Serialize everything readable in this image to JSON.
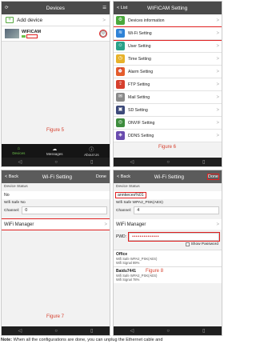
{
  "fig5": {
    "title": "Devices",
    "add_device": "Add device",
    "camera_name": "WIFICAM",
    "caption": "Figure 5",
    "tabs": [
      "Devices",
      "Messages",
      "About Us"
    ]
  },
  "fig6": {
    "back": "< List",
    "title": "WIFICAM Setting",
    "items": [
      {
        "label": "Devices information",
        "color": "#4aa83c"
      },
      {
        "label": "Wi-Fi Setting",
        "color": "#2f82d6"
      },
      {
        "label": "User Setting",
        "color": "#2aa189"
      },
      {
        "label": "Time Setting",
        "color": "#e7b22a"
      },
      {
        "label": "Alarm Setting",
        "color": "#e45d2b"
      },
      {
        "label": "FTP Setting",
        "color": "#d6402e"
      },
      {
        "label": "Mail Setting",
        "color": "#8a8a8a"
      },
      {
        "label": "SD Setting",
        "color": "#3d4a7a"
      },
      {
        "label": "ONVIF Setting",
        "color": "#3d8c3d"
      },
      {
        "label": "DDNS Setting",
        "color": "#6a4caf"
      }
    ],
    "caption": "Figure 6"
  },
  "fig7": {
    "back": "< Back",
    "title": "Wi-Fi Setting",
    "done": "Done",
    "device_status": "Device Status",
    "status_value": "No",
    "wifi_safe_label": "Wifi Safe",
    "wifi_safe_value": "No",
    "channel_label": "Channel:",
    "channel_value": "0",
    "wifi_manager": "WiFi Manager",
    "caption": "Figure 7"
  },
  "fig8": {
    "back": "< Back",
    "title": "Wi-Fi Setting",
    "done": "Done",
    "device_status": "Device Status",
    "ssid": "annkeces%01",
    "wifi_safe_label": "Wifi Safe",
    "wifi_safe_value": "WPA2_PSK(AES)",
    "channel_label": "Channel:",
    "channel_value": "4",
    "wifi_manager": "WiFi Manager",
    "pwd_label": "PWD:",
    "pwd_value": "••••••••••••••",
    "show_password": "Show Password",
    "networks": [
      {
        "name": "Office",
        "safe": "Wifi Safe  WPA2_PSK(AES)",
        "signal": "Wifi Signal  89%"
      },
      {
        "name": "Baidu7441",
        "safe": "Wifi Safe  WPA2_PSK(AES)",
        "signal": "Wifi Signal  78%"
      }
    ],
    "caption": "Figure 8"
  },
  "note": {
    "bold": "Note:",
    "text": " When all the configurations are done, you can unplug the Ethernet cable and"
  }
}
